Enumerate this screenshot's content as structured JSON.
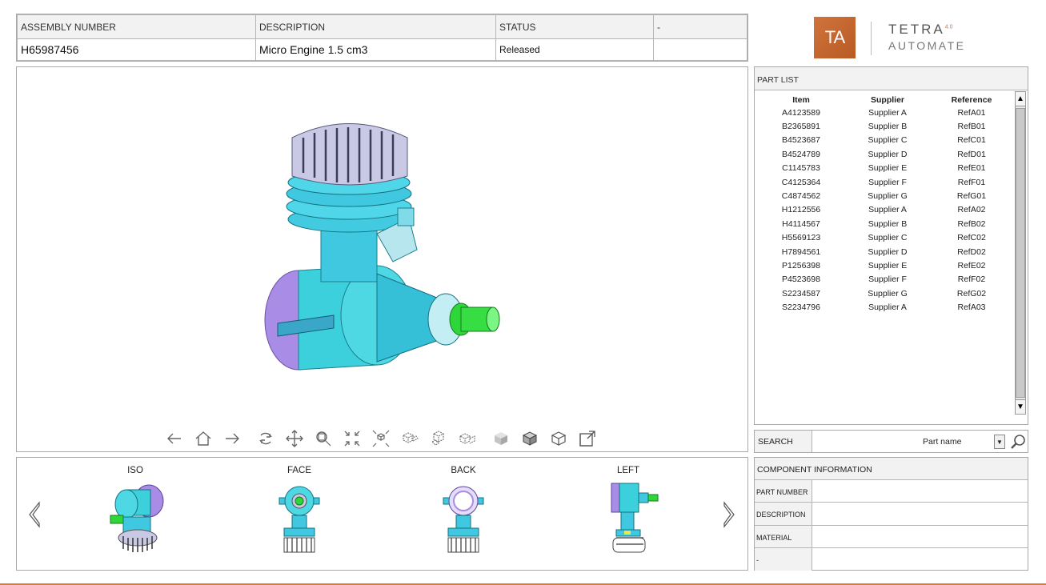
{
  "header": {
    "columns": [
      "ASSEMBLY NUMBER",
      "DESCRIPTION",
      "STATUS",
      "-"
    ],
    "values": [
      "H65987456",
      "Micro Engine 1.5 cm3",
      "Released",
      ""
    ]
  },
  "logo": {
    "mark": "TA",
    "name": "TETRA",
    "superscript": "4.0",
    "tagline": "AUTOMATE"
  },
  "toolbar": {
    "icons": [
      "back-arrow-icon",
      "home-icon",
      "forward-arrow-icon",
      "rotate-icon",
      "pan-icon",
      "zoom-icon",
      "fit-all-icon",
      "explode-icon",
      "view-cube-1-icon",
      "view-cube-2-icon",
      "view-cube-3-icon",
      "shaded-icon",
      "shaded-edges-icon",
      "wireframe-icon",
      "fullscreen-icon"
    ]
  },
  "thumbnails": [
    {
      "label": "ISO"
    },
    {
      "label": "FACE"
    },
    {
      "label": "BACK"
    },
    {
      "label": "LEFT"
    }
  ],
  "part_list": {
    "title": "PART LIST",
    "columns": [
      "Item",
      "Supplier",
      "Reference"
    ],
    "rows": [
      [
        "A4123589",
        "Supplier A",
        "RefA01"
      ],
      [
        "B2365891",
        "Supplier B",
        "RefB01"
      ],
      [
        "B4523687",
        "Supplier C",
        "RefC01"
      ],
      [
        "B4524789",
        "Supplier D",
        "RefD01"
      ],
      [
        "C1145783",
        "Supplier E",
        "RefE01"
      ],
      [
        "C4125364",
        "Supplier F",
        "RefF01"
      ],
      [
        "C4874562",
        "Supplier G",
        "RefG01"
      ],
      [
        "H1212556",
        "Supplier A",
        "RefA02"
      ],
      [
        "H4114567",
        "Supplier B",
        "RefB02"
      ],
      [
        "H5569123",
        "Supplier C",
        "RefC02"
      ],
      [
        "H7894561",
        "Supplier D",
        "RefD02"
      ],
      [
        "P1256398",
        "Supplier E",
        "RefE02"
      ],
      [
        "P4523698",
        "Supplier F",
        "RefF02"
      ],
      [
        "S2234587",
        "Supplier G",
        "RefG02"
      ],
      [
        "S2234796",
        "Supplier A",
        "RefA03"
      ]
    ]
  },
  "search": {
    "label": "SEARCH",
    "value": "Part name"
  },
  "component_info": {
    "title": "COMPONENT INFORMATION",
    "fields": [
      {
        "key": "PART NUMBER",
        "value": ""
      },
      {
        "key": "DESCRIPTION",
        "value": ""
      },
      {
        "key": "MATERIAL",
        "value": ""
      },
      {
        "key": "-",
        "value": ""
      }
    ]
  },
  "colors": {
    "accent": "#e07a30",
    "logo": "#c7652e",
    "cyan": "#35d6e0",
    "purple": "#a78ae6",
    "green": "#2fd63a"
  }
}
